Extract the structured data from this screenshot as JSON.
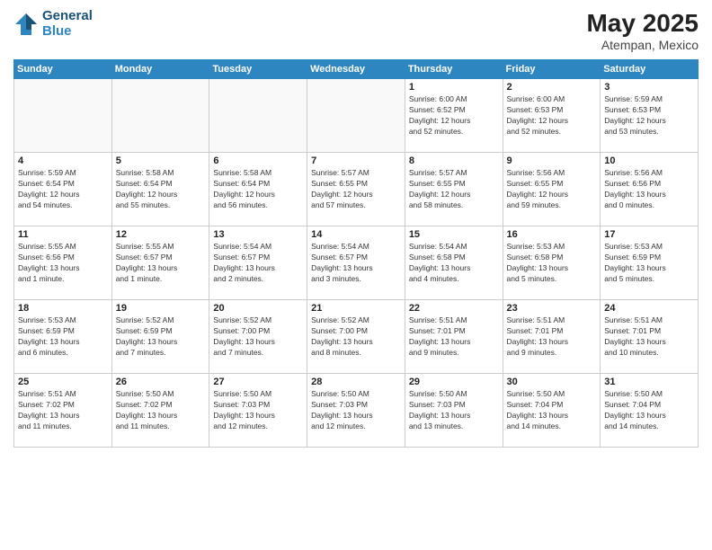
{
  "header": {
    "logo_line1": "General",
    "logo_line2": "Blue",
    "month_year": "May 2025",
    "location": "Atempan, Mexico"
  },
  "days_of_week": [
    "Sunday",
    "Monday",
    "Tuesday",
    "Wednesday",
    "Thursday",
    "Friday",
    "Saturday"
  ],
  "weeks": [
    [
      {
        "day": "",
        "info": ""
      },
      {
        "day": "",
        "info": ""
      },
      {
        "day": "",
        "info": ""
      },
      {
        "day": "",
        "info": ""
      },
      {
        "day": "1",
        "info": "Sunrise: 6:00 AM\nSunset: 6:52 PM\nDaylight: 12 hours\nand 52 minutes."
      },
      {
        "day": "2",
        "info": "Sunrise: 6:00 AM\nSunset: 6:53 PM\nDaylight: 12 hours\nand 52 minutes."
      },
      {
        "day": "3",
        "info": "Sunrise: 5:59 AM\nSunset: 6:53 PM\nDaylight: 12 hours\nand 53 minutes."
      }
    ],
    [
      {
        "day": "4",
        "info": "Sunrise: 5:59 AM\nSunset: 6:54 PM\nDaylight: 12 hours\nand 54 minutes."
      },
      {
        "day": "5",
        "info": "Sunrise: 5:58 AM\nSunset: 6:54 PM\nDaylight: 12 hours\nand 55 minutes."
      },
      {
        "day": "6",
        "info": "Sunrise: 5:58 AM\nSunset: 6:54 PM\nDaylight: 12 hours\nand 56 minutes."
      },
      {
        "day": "7",
        "info": "Sunrise: 5:57 AM\nSunset: 6:55 PM\nDaylight: 12 hours\nand 57 minutes."
      },
      {
        "day": "8",
        "info": "Sunrise: 5:57 AM\nSunset: 6:55 PM\nDaylight: 12 hours\nand 58 minutes."
      },
      {
        "day": "9",
        "info": "Sunrise: 5:56 AM\nSunset: 6:55 PM\nDaylight: 12 hours\nand 59 minutes."
      },
      {
        "day": "10",
        "info": "Sunrise: 5:56 AM\nSunset: 6:56 PM\nDaylight: 13 hours\nand 0 minutes."
      }
    ],
    [
      {
        "day": "11",
        "info": "Sunrise: 5:55 AM\nSunset: 6:56 PM\nDaylight: 13 hours\nand 1 minute."
      },
      {
        "day": "12",
        "info": "Sunrise: 5:55 AM\nSunset: 6:57 PM\nDaylight: 13 hours\nand 1 minute."
      },
      {
        "day": "13",
        "info": "Sunrise: 5:54 AM\nSunset: 6:57 PM\nDaylight: 13 hours\nand 2 minutes."
      },
      {
        "day": "14",
        "info": "Sunrise: 5:54 AM\nSunset: 6:57 PM\nDaylight: 13 hours\nand 3 minutes."
      },
      {
        "day": "15",
        "info": "Sunrise: 5:54 AM\nSunset: 6:58 PM\nDaylight: 13 hours\nand 4 minutes."
      },
      {
        "day": "16",
        "info": "Sunrise: 5:53 AM\nSunset: 6:58 PM\nDaylight: 13 hours\nand 5 minutes."
      },
      {
        "day": "17",
        "info": "Sunrise: 5:53 AM\nSunset: 6:59 PM\nDaylight: 13 hours\nand 5 minutes."
      }
    ],
    [
      {
        "day": "18",
        "info": "Sunrise: 5:53 AM\nSunset: 6:59 PM\nDaylight: 13 hours\nand 6 minutes."
      },
      {
        "day": "19",
        "info": "Sunrise: 5:52 AM\nSunset: 6:59 PM\nDaylight: 13 hours\nand 7 minutes."
      },
      {
        "day": "20",
        "info": "Sunrise: 5:52 AM\nSunset: 7:00 PM\nDaylight: 13 hours\nand 7 minutes."
      },
      {
        "day": "21",
        "info": "Sunrise: 5:52 AM\nSunset: 7:00 PM\nDaylight: 13 hours\nand 8 minutes."
      },
      {
        "day": "22",
        "info": "Sunrise: 5:51 AM\nSunset: 7:01 PM\nDaylight: 13 hours\nand 9 minutes."
      },
      {
        "day": "23",
        "info": "Sunrise: 5:51 AM\nSunset: 7:01 PM\nDaylight: 13 hours\nand 9 minutes."
      },
      {
        "day": "24",
        "info": "Sunrise: 5:51 AM\nSunset: 7:01 PM\nDaylight: 13 hours\nand 10 minutes."
      }
    ],
    [
      {
        "day": "25",
        "info": "Sunrise: 5:51 AM\nSunset: 7:02 PM\nDaylight: 13 hours\nand 11 minutes."
      },
      {
        "day": "26",
        "info": "Sunrise: 5:50 AM\nSunset: 7:02 PM\nDaylight: 13 hours\nand 11 minutes."
      },
      {
        "day": "27",
        "info": "Sunrise: 5:50 AM\nSunset: 7:03 PM\nDaylight: 13 hours\nand 12 minutes."
      },
      {
        "day": "28",
        "info": "Sunrise: 5:50 AM\nSunset: 7:03 PM\nDaylight: 13 hours\nand 12 minutes."
      },
      {
        "day": "29",
        "info": "Sunrise: 5:50 AM\nSunset: 7:03 PM\nDaylight: 13 hours\nand 13 minutes."
      },
      {
        "day": "30",
        "info": "Sunrise: 5:50 AM\nSunset: 7:04 PM\nDaylight: 13 hours\nand 14 minutes."
      },
      {
        "day": "31",
        "info": "Sunrise: 5:50 AM\nSunset: 7:04 PM\nDaylight: 13 hours\nand 14 minutes."
      }
    ]
  ]
}
